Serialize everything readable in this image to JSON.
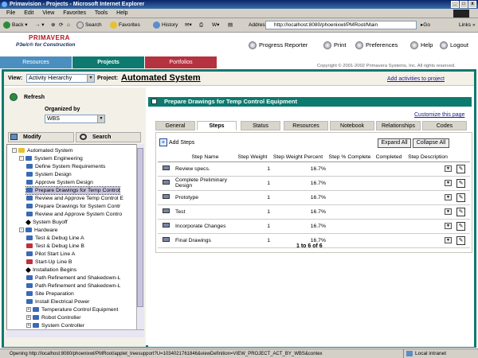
{
  "window": {
    "title": "Primavision - Projects - Microsoft Internet Explorer",
    "btn_min": "_",
    "btn_max": "□",
    "btn_close": "x"
  },
  "menu": [
    "File",
    "Edit",
    "View",
    "Favorites",
    "Tools",
    "Help"
  ],
  "toolbar": {
    "back": "Back",
    "search": "Search",
    "favorites": "Favorites",
    "history": "History",
    "address_label": "Address",
    "address": "http://localhost:8080/phoenixwl/PMRoot/Main",
    "go": "Go",
    "links": "Links"
  },
  "header": {
    "logo": "PRIMAVERA",
    "product": "P3e/c® for Construction",
    "progress_reporter": "Progress Reporter",
    "print": "Print",
    "preferences": "Preferences",
    "help": "Help",
    "logout": "Logout",
    "copyright": "Copyright © 2001-2002 Primavera Systems, Inc. All rights reserved."
  },
  "tabs": [
    {
      "label": "Resources",
      "color": "#4a8fc0"
    },
    {
      "label": "Projects",
      "color": "#0c7a6f"
    },
    {
      "label": "Portfolios",
      "color": "#b5323f"
    }
  ],
  "viewbar": {
    "view_label": "View:",
    "view_value": "Activity Hierarchy",
    "project_label": "Project:",
    "project_name": "Automated System",
    "add_link": "Add activities to project"
  },
  "left": {
    "refresh": "Refresh",
    "organized_by_label": "Organized by",
    "organized_by": "WBS",
    "modify": "Modify",
    "search": "Search"
  },
  "tree": [
    {
      "label": "Automated System",
      "level": 0,
      "kind": "folder",
      "expand": "-"
    },
    {
      "label": "System Engineering",
      "level": 1,
      "kind": "wbs",
      "expand": "-"
    },
    {
      "label": "Define System Requirements",
      "level": 2,
      "kind": "act"
    },
    {
      "label": "System Design",
      "level": 2,
      "kind": "act"
    },
    {
      "label": "Approve System Design",
      "level": 2,
      "kind": "act"
    },
    {
      "label": "Prepare Drawings for Temp Control",
      "level": 2,
      "kind": "act",
      "selected": true
    },
    {
      "label": "Review and Approve Temp Control E",
      "level": 2,
      "kind": "act"
    },
    {
      "label": "Prepare Drawings for System Contr",
      "level": 2,
      "kind": "act"
    },
    {
      "label": "Review and Approve System Contro",
      "level": 2,
      "kind": "act"
    },
    {
      "label": "System Buyoff",
      "level": 2,
      "kind": "mile"
    },
    {
      "label": "Hardware",
      "level": 1,
      "kind": "wbs",
      "expand": "-"
    },
    {
      "label": "Test & Debug Line A",
      "level": 2,
      "kind": "act"
    },
    {
      "label": "Test & Debug Line B",
      "level": 2,
      "kind": "actred"
    },
    {
      "label": "Pilot Start Line A",
      "level": 2,
      "kind": "act"
    },
    {
      "label": "Start-Up Line B",
      "level": 2,
      "kind": "actred"
    },
    {
      "label": "Installation Begins",
      "level": 2,
      "kind": "mile"
    },
    {
      "label": "Path Refinement and Shakedown-L",
      "level": 2,
      "kind": "act"
    },
    {
      "label": "Path Refinement and Shakedown-L",
      "level": 2,
      "kind": "act"
    },
    {
      "label": "Site Preparation",
      "level": 2,
      "kind": "act"
    },
    {
      "label": "Install Electrical Power",
      "level": 2,
      "kind": "act"
    },
    {
      "label": "Temperature Control Equipment",
      "level": 2,
      "kind": "wbs",
      "expand": "+"
    },
    {
      "label": "Robot Controller",
      "level": 2,
      "kind": "wbs",
      "expand": "+"
    },
    {
      "label": "System Controller",
      "level": 2,
      "kind": "wbs",
      "expand": "+"
    }
  ],
  "detail": {
    "title": "Prepare Drawings for Temp Control Equipment",
    "customize": "Customize this page",
    "tabs": [
      "General",
      "Steps",
      "Status",
      "Resources",
      "Notebook",
      "Relationships",
      "Codes"
    ],
    "active_tab": "Steps",
    "add_steps": "Add Steps",
    "expand_all": "Expand All",
    "collapse_all": "Collapse All",
    "columns": [
      "Step Name",
      "Step Weight",
      "Step Weight Percent",
      "Step % Complete",
      "Completed",
      "Step Description"
    ],
    "rows": [
      {
        "name": "Review specs.",
        "weight": "1",
        "percent": "16.7%"
      },
      {
        "name": "Complete Preliminary Design",
        "weight": "1",
        "percent": "16.7%"
      },
      {
        "name": "Prototype",
        "weight": "1",
        "percent": "16.7%"
      },
      {
        "name": "Test",
        "weight": "1",
        "percent": "16.7%"
      },
      {
        "name": "Incorporate Changes",
        "weight": "1",
        "percent": "16.7%"
      },
      {
        "name": "Final Drawings",
        "weight": "1",
        "percent": "16.7%"
      }
    ],
    "pager": "1 to 6 of 6"
  },
  "status": {
    "text": "Opening http://localhost:8080/phoenixwl/PMRoot/applet_treesupport?U=1034021761846&viewDefinition=VIEW_PROJECT_ACT_BY_WBS&contex",
    "zone": "Local intranet"
  }
}
